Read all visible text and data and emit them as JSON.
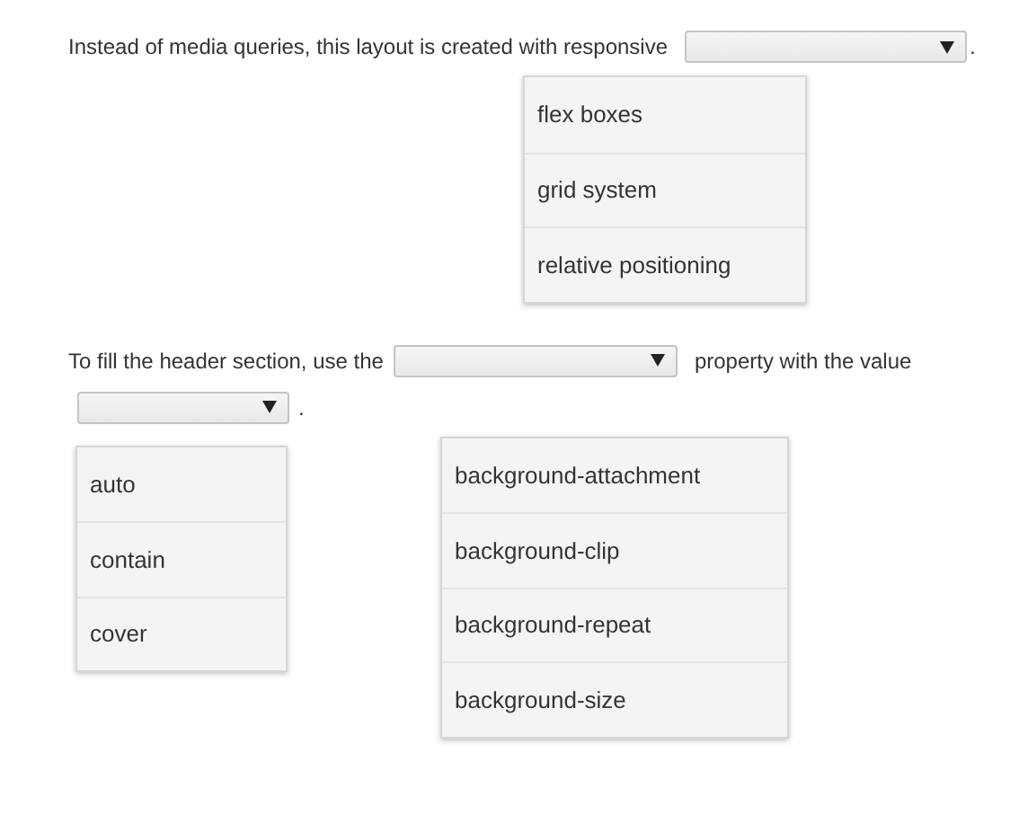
{
  "question_1": {
    "prompt": "Instead of media queries, this layout is created with responsive",
    "end": ".",
    "options": [
      "flex boxes",
      "grid system",
      "relative positioning"
    ]
  },
  "question_2": {
    "prompt": "To fill the header section, use the",
    "middle": "property with the value",
    "end": ".",
    "value_options": [
      "auto",
      "contain",
      "cover"
    ],
    "property_options": [
      "background-attachment",
      "background-clip",
      "background-repeat",
      "background-size"
    ]
  }
}
